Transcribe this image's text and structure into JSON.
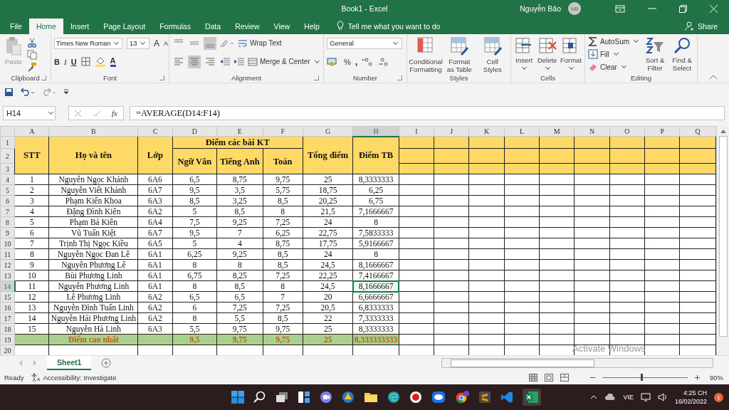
{
  "title_bar": {
    "title": "Book1  -  Excel",
    "user": "Nguyễn Bảo",
    "initials": "NB"
  },
  "tabs": [
    {
      "label": "File",
      "selected": false
    },
    {
      "label": "Home",
      "selected": true
    },
    {
      "label": "Insert",
      "selected": false
    },
    {
      "label": "Page Layout",
      "selected": false
    },
    {
      "label": "Formulas",
      "selected": false
    },
    {
      "label": "Data",
      "selected": false
    },
    {
      "label": "Review",
      "selected": false
    },
    {
      "label": "View",
      "selected": false
    },
    {
      "label": "Help",
      "selected": false
    }
  ],
  "tell_me": "Tell me what you want to do",
  "share": "Share",
  "ribbon": {
    "clipboard": {
      "label": "Clipboard",
      "paste": "Paste"
    },
    "font": {
      "label": "Font",
      "name": "Times New Roman",
      "size": "13",
      "grow": "A",
      "shrink": "A",
      "bold": "B",
      "italic": "I",
      "underline": "U",
      "color_letter": "A"
    },
    "alignment": {
      "label": "Alignment",
      "wrap": "Wrap Text",
      "merge": "Merge & Center"
    },
    "number": {
      "label": "Number",
      "format": "General",
      "percent": "%",
      "comma": ","
    },
    "styles": {
      "label": "Styles",
      "buttons": [
        "Conditional Formatting",
        "Format as Table",
        "Cell Styles"
      ]
    },
    "cells": {
      "label": "Cells",
      "buttons": [
        "Insert",
        "Delete",
        "Format"
      ]
    },
    "editing": {
      "label": "Editing",
      "autosum": "AutoSum",
      "fill": "Fill",
      "clear": "Clear",
      "buttons": [
        "Sort & Filter",
        "Find & Select"
      ]
    }
  },
  "formula_bar": {
    "name_box": "H14",
    "fx": "fx",
    "formula": "=AVERAGE(D14:F14)"
  },
  "sheet": {
    "columns": [
      {
        "label": "A",
        "selected": false
      },
      {
        "label": "B",
        "selected": false
      },
      {
        "label": "C",
        "selected": false
      },
      {
        "label": "D",
        "selected": false
      },
      {
        "label": "E",
        "selected": false
      },
      {
        "label": "F",
        "selected": false
      },
      {
        "label": "G",
        "selected": false
      },
      {
        "label": "H",
        "selected": true
      },
      {
        "label": "I",
        "selected": false
      },
      {
        "label": "J",
        "selected": false
      },
      {
        "label": "K",
        "selected": false
      },
      {
        "label": "L",
        "selected": false
      },
      {
        "label": "M",
        "selected": false
      },
      {
        "label": "N",
        "selected": false
      },
      {
        "label": "O",
        "selected": false
      },
      {
        "label": "P",
        "selected": false
      },
      {
        "label": "Q",
        "selected": false
      }
    ],
    "row_numbers": [
      "1",
      "2",
      "3",
      "4",
      "5",
      "6",
      "7",
      "8",
      "9",
      "10",
      "11",
      "12",
      "13",
      "14",
      "15",
      "16",
      "17",
      "18",
      "19",
      "20"
    ],
    "header": {
      "stt": "STT",
      "name": "Họ và tên",
      "class": "Lớp",
      "group": "Điểm các bài KT",
      "subjects": [
        "Ngữ Văn",
        "Tiếng Anh",
        "Toán"
      ],
      "total": "Tổng điểm",
      "average": "Điểm TB"
    },
    "rows": [
      {
        "cells": [
          "1",
          "Nguyễn Ngọc Khánh",
          "6A6",
          "6,5",
          "8,75",
          "9,75",
          "25",
          "8,3333333"
        ],
        "selected": false
      },
      {
        "cells": [
          "2",
          "Nguyễn Viết Khánh",
          "6A7",
          "9,5",
          "3,5",
          "5,75",
          "18,75",
          "6,25"
        ],
        "selected": false
      },
      {
        "cells": [
          "3",
          "Phạm Kiến Khoa",
          "6A3",
          "8,5",
          "3,25",
          "8,5",
          "20,25",
          "6,75"
        ],
        "selected": false
      },
      {
        "cells": [
          "4",
          "Đặng Đình Kiên",
          "6A2",
          "5",
          "8,5",
          "8",
          "21,5",
          "7,1666667"
        ],
        "selected": false
      },
      {
        "cells": [
          "5",
          "Phạm Bá Kiên",
          "6A4",
          "7,5",
          "9,25",
          "7,25",
          "24",
          "8"
        ],
        "selected": false
      },
      {
        "cells": [
          "6",
          "Vũ Tuấn Kiệt",
          "6A7",
          "9,5",
          "7",
          "6,25",
          "22,75",
          "7,5833333"
        ],
        "selected": false
      },
      {
        "cells": [
          "7",
          "Trịnh Thị Ngọc Kiều",
          "6A5",
          "5",
          "4",
          "8,75",
          "17,75",
          "5,9166667"
        ],
        "selected": false
      },
      {
        "cells": [
          "8",
          "Nguyễn Ngọc Đan Lê",
          "6A1",
          "6,25",
          "9,25",
          "8,5",
          "24",
          "8"
        ],
        "selected": false
      },
      {
        "cells": [
          "9",
          "Nguyễn Phương Lê",
          "6A1",
          "8",
          "8",
          "8,5",
          "24,5",
          "8,1666667"
        ],
        "selected": false
      },
      {
        "cells": [
          "10",
          "Bùi Phương Linh",
          "6A1",
          "6,75",
          "8,25",
          "7,25",
          "22,25",
          "7,4166667"
        ],
        "selected": false
      },
      {
        "cells": [
          "11",
          "Nguyễn Phương Linh",
          "6A1",
          "8",
          "8,5",
          "8",
          "24,5",
          "8,1666667"
        ],
        "selected": true
      },
      {
        "cells": [
          "12",
          "Lê Phương Linh",
          "6A2",
          "6,5",
          "6,5",
          "7",
          "20",
          "6,6666667"
        ],
        "selected": false
      },
      {
        "cells": [
          "13",
          "Nguyễn Đình Tuấn Linh",
          "6A2",
          "6",
          "7,25",
          "7,25",
          "20,5",
          "6,8333333"
        ],
        "selected": false
      },
      {
        "cells": [
          "14",
          "Nguyễn Hải Phương Linh",
          "6A2",
          "8",
          "5,5",
          "8,5",
          "22",
          "7,3333333"
        ],
        "selected": false
      },
      {
        "cells": [
          "15",
          "Nguyễn Hà Linh",
          "6A3",
          "5,5",
          "9,75",
          "9,75",
          "25",
          "8,3333333"
        ],
        "selected": false
      }
    ],
    "summary": {
      "label": "Điểm cao nhất",
      "values": [
        "9,5",
        "9,75",
        "9,75",
        "25",
        "8,333333333"
      ]
    }
  },
  "sheet_tabs": [
    {
      "label": "Sheet1",
      "selected": true
    }
  ],
  "status": {
    "mode": "Ready",
    "accessibility": "Accessibility: Investigate",
    "zoom": "90%"
  },
  "zoom_slider": {
    "level": 0.45
  },
  "activation": {
    "title": "Activate Windows"
  },
  "taskbar": {
    "language": "VIE",
    "time": "4:25 CH",
    "date": "16/02/2022",
    "notifications": "1"
  }
}
